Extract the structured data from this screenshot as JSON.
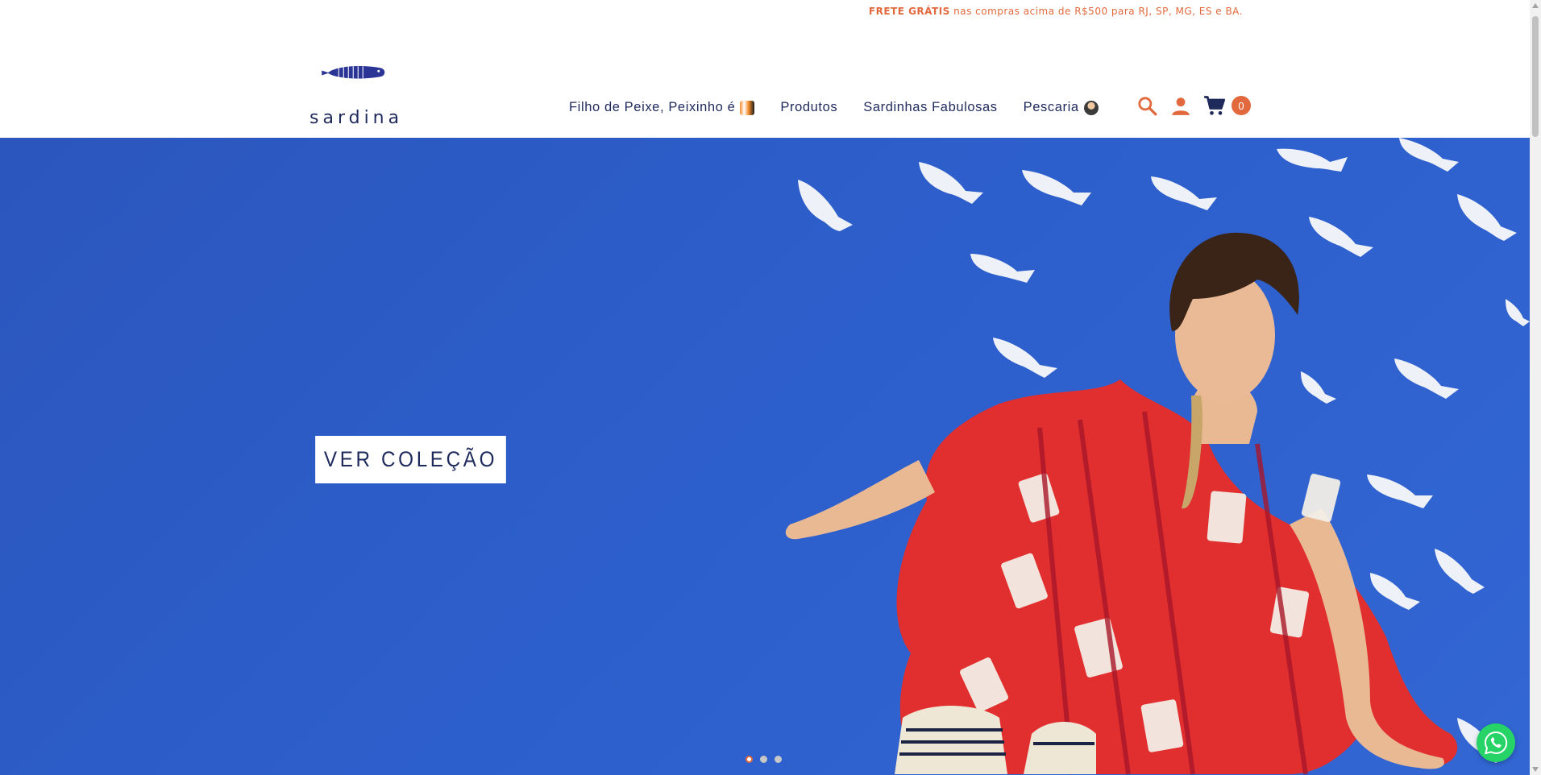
{
  "promo": {
    "bold": "FRETE GRÁTIS",
    "rest": " nas compras acima de R$500 para RJ, SP, MG, ES e BA."
  },
  "logo": {
    "word": "sardina"
  },
  "nav": {
    "items": [
      {
        "label": "Filho de Peixe, Peixinho é",
        "emoji_icon": "fish-emoji"
      },
      {
        "label": "Produtos"
      },
      {
        "label": "Sardinhas Fabulosas"
      },
      {
        "label": "Pescaria",
        "emoji_icon": "person-emoji"
      }
    ]
  },
  "header_icons": {
    "search": "search-icon",
    "account": "user-icon",
    "cart": "cart-icon",
    "cart_count": "0"
  },
  "hero": {
    "cta_label": "VER COLEÇÃO",
    "slides": 3,
    "active_slide": 1
  },
  "colors": {
    "accent": "#e2693d",
    "navy": "#1f2a5c",
    "hero_blue": "#2d5fcc",
    "whatsapp": "#25d366"
  }
}
